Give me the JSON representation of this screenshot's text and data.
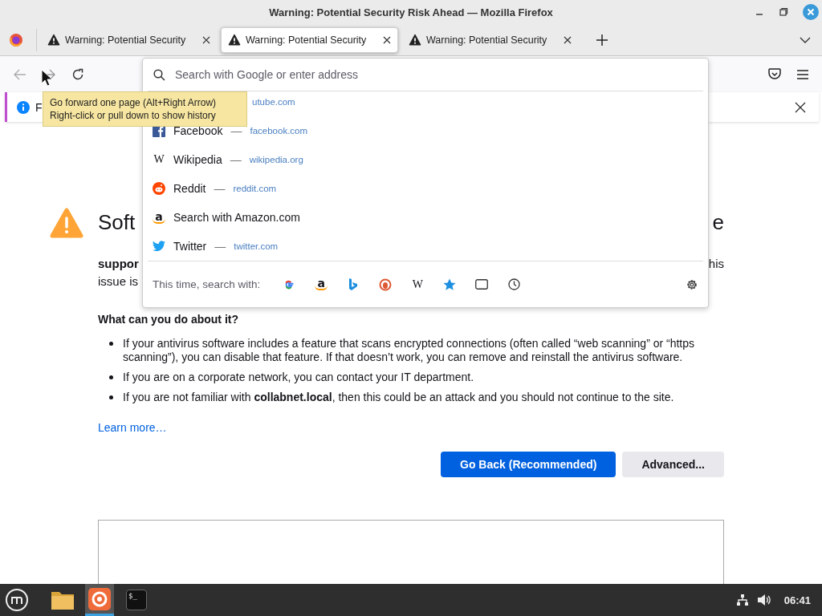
{
  "window": {
    "title": "Warning: Potential Security Risk Ahead — Mozilla Firefox"
  },
  "tabs": [
    {
      "label": "Warning: Potential Security",
      "selected": false
    },
    {
      "label": "Warning: Potential Security",
      "selected": true
    },
    {
      "label": "Warning: Potential Security",
      "selected": false
    }
  ],
  "tooltip": {
    "lines": [
      "Go forward one page (Alt+Right Arrow)",
      "Right-click or pull down to show history"
    ]
  },
  "notification": {
    "text": "F"
  },
  "address_dropdown": {
    "placeholder": "Search with Google or enter address",
    "suggestions": [
      {
        "kind": "covered",
        "url": "utube.com"
      },
      {
        "kind": "facebook",
        "title": "Facebook",
        "separator": "—",
        "url": "facebook.com"
      },
      {
        "kind": "wikipedia",
        "glyph": "W",
        "title": "Wikipedia",
        "separator": "—",
        "url": "wikipedia.org"
      },
      {
        "kind": "reddit",
        "title": "Reddit",
        "separator": "—",
        "url": "reddit.com"
      },
      {
        "kind": "amazon",
        "glyph": "a",
        "title": "Search with Amazon.com"
      },
      {
        "kind": "twitter",
        "title": "Twitter",
        "separator": "—",
        "url": "twitter.com"
      }
    ],
    "footer_label": "This time, search with:",
    "engines": [
      {
        "kind": "google"
      },
      {
        "kind": "amazon",
        "glyph": "a"
      },
      {
        "kind": "bing"
      },
      {
        "kind": "duckduckgo"
      },
      {
        "kind": "wikipedia",
        "glyph": "W"
      },
      {
        "kind": "bookmarks"
      },
      {
        "kind": "tabs"
      },
      {
        "kind": "history"
      }
    ]
  },
  "error_page": {
    "heading_start": "Soft",
    "heading_end": "e",
    "line1_start": "suppor",
    "line1_end": "his",
    "line2_start": "issue is",
    "subheading": "What can you do about it?",
    "bullets": [
      "If your antivirus software includes a feature that scans encrypted connections (often called “web scanning” or “https scanning”), you can disable that feature. If that doesn’t work, you can remove and reinstall the antivirus software.",
      "If you are on a corporate network, you can contact your IT department.",
      "If you are not familiar with **collabnet.local**, then this could be an attack and you should not continue to the site."
    ],
    "learn_more": "Learn more…",
    "buttons": [
      {
        "kind": "primary",
        "label": "Go Back (Recommended)"
      },
      {
        "kind": "secondary",
        "label": "Advanced..."
      }
    ]
  },
  "taskbar": {
    "apps": [
      {
        "kind": "files",
        "selected": false
      },
      {
        "kind": "firefox",
        "selected": true
      },
      {
        "kind": "terminal",
        "glyph": "$_",
        "selected": false
      }
    ],
    "clock": "06:41"
  }
}
